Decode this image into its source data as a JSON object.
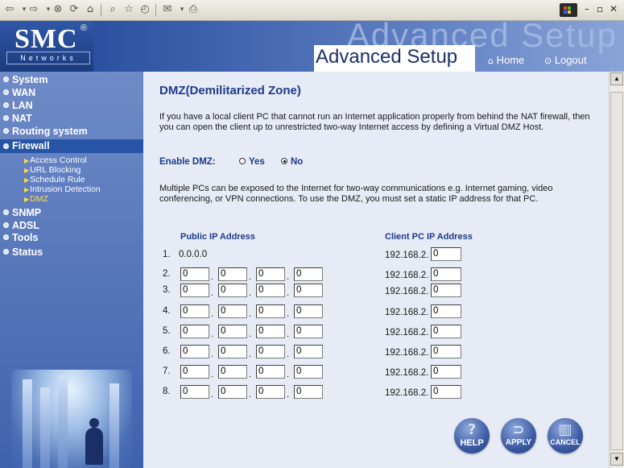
{
  "browser": {
    "icons": [
      "back-icon",
      "forward-icon",
      "stop-icon",
      "refresh-icon",
      "home-icon",
      "search-icon",
      "favorites-icon",
      "history-icon",
      "mail-icon",
      "print-icon"
    ],
    "window_controls": [
      "–",
      "▫",
      "✕"
    ]
  },
  "header": {
    "logo": "SMC",
    "logo_reg": "®",
    "logo_sub": "Networks",
    "ghost_title": "Advanced Setup",
    "title": "Advanced Setup",
    "home_label": "Home",
    "logout_label": "Logout"
  },
  "sidebar": {
    "items": [
      {
        "label": "System"
      },
      {
        "label": "WAN"
      },
      {
        "label": "LAN"
      },
      {
        "label": "NAT"
      },
      {
        "label": "Routing system"
      },
      {
        "label": "Firewall"
      },
      {
        "label": "SNMP"
      },
      {
        "label": "ADSL"
      },
      {
        "label": "Tools"
      },
      {
        "label": "Status"
      }
    ],
    "firewall_sub": [
      {
        "label": "Access Control"
      },
      {
        "label": "URL Blocking"
      },
      {
        "label": "Schedule Rule"
      },
      {
        "label": "Intrusion Detection"
      },
      {
        "label": "DMZ"
      }
    ]
  },
  "main": {
    "title": "DMZ(Demilitarized Zone)",
    "intro": "If you have a local client PC that cannot run an Internet application properly from behind the NAT firewall, then you can open the client up to unrestricted two-way Internet access by defining a Virtual DMZ Host.",
    "enable_label": "Enable DMZ:",
    "yes_label": "Yes",
    "no_label": "No",
    "selected": "No",
    "multi_text": "Multiple PCs can be exposed to the Internet for two-way communications e.g. Internet gaming, video conferencing, or VPN connections.  To use the DMZ, you must set a static IP address for that PC.",
    "public_header": "Public IP Address",
    "client_header": "Client PC IP Address",
    "row1": {
      "num": "1.",
      "public": "0.0.0.0",
      "client_prefix": "192.168.2.",
      "client_value": "0"
    },
    "rows": [
      {
        "num": "2.",
        "oct": [
          "0",
          "0",
          "0",
          "0"
        ],
        "client_prefix": "192.168.2.",
        "client_value": "0"
      },
      {
        "num": "3.",
        "oct": [
          "0",
          "0",
          "0",
          "0"
        ],
        "client_prefix": "192.168.2.",
        "client_value": "0"
      },
      {
        "num": "4.",
        "oct": [
          "0",
          "0",
          "0",
          "0"
        ],
        "client_prefix": "192.168.2.",
        "client_value": "0"
      },
      {
        "num": "5.",
        "oct": [
          "0",
          "0",
          "0",
          "0"
        ],
        "client_prefix": "192.168.2.",
        "client_value": "0"
      },
      {
        "num": "6.",
        "oct": [
          "0",
          "0",
          "0",
          "0"
        ],
        "client_prefix": "192.168.2.",
        "client_value": "0"
      },
      {
        "num": "7.",
        "oct": [
          "0",
          "0",
          "0",
          "0"
        ],
        "client_prefix": "192.168.2.",
        "client_value": "0"
      },
      {
        "num": "8.",
        "oct": [
          "0",
          "0",
          "0",
          "0"
        ],
        "client_prefix": "192.168.2.",
        "client_value": "0"
      }
    ],
    "buttons": {
      "help": "HELP",
      "apply": "APPLY",
      "cancel": "CANCEL"
    }
  },
  "colors": {
    "header": "#1c3f88",
    "sidebar": "#4f70b5",
    "title": "#1d3a8a",
    "main_bg": "#e6ebf5",
    "submenu_selected": "#ffd84a"
  }
}
